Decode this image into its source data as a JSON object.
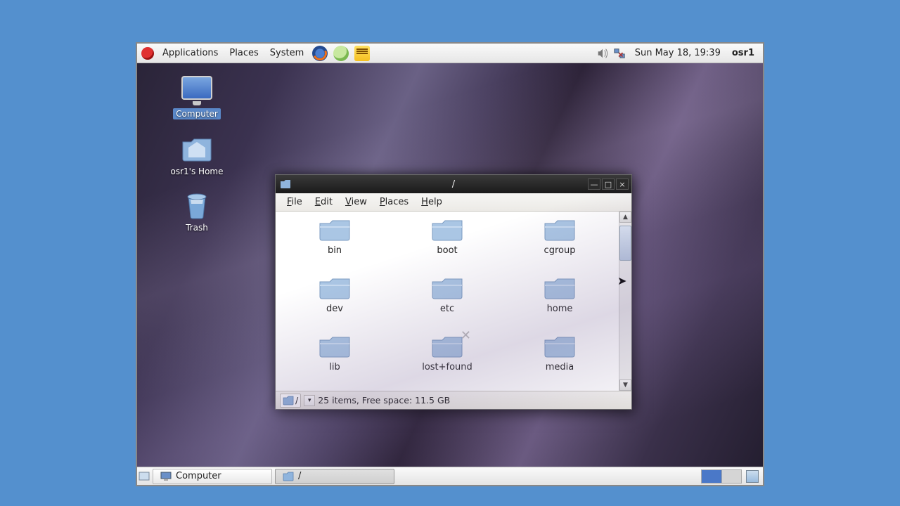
{
  "panel": {
    "menus": [
      "Applications",
      "Places",
      "System"
    ],
    "clock": "Sun May 18, 19:39",
    "user": "osr1"
  },
  "desktop_icons": {
    "computer": "Computer",
    "home": "osr1's Home",
    "trash": "Trash"
  },
  "fm": {
    "title": "/",
    "menus": {
      "file": "File",
      "edit": "Edit",
      "view": "View",
      "places": "Places",
      "help": "Help"
    },
    "folders": [
      "bin",
      "boot",
      "cgroup",
      "dev",
      "etc",
      "home",
      "lib",
      "lost+found",
      "media"
    ],
    "locked_folder": "lost+found",
    "path": "/",
    "status": "25 items, Free space: 11.5 GB"
  },
  "taskbar": {
    "btn1": "Computer",
    "btn2": "/"
  }
}
